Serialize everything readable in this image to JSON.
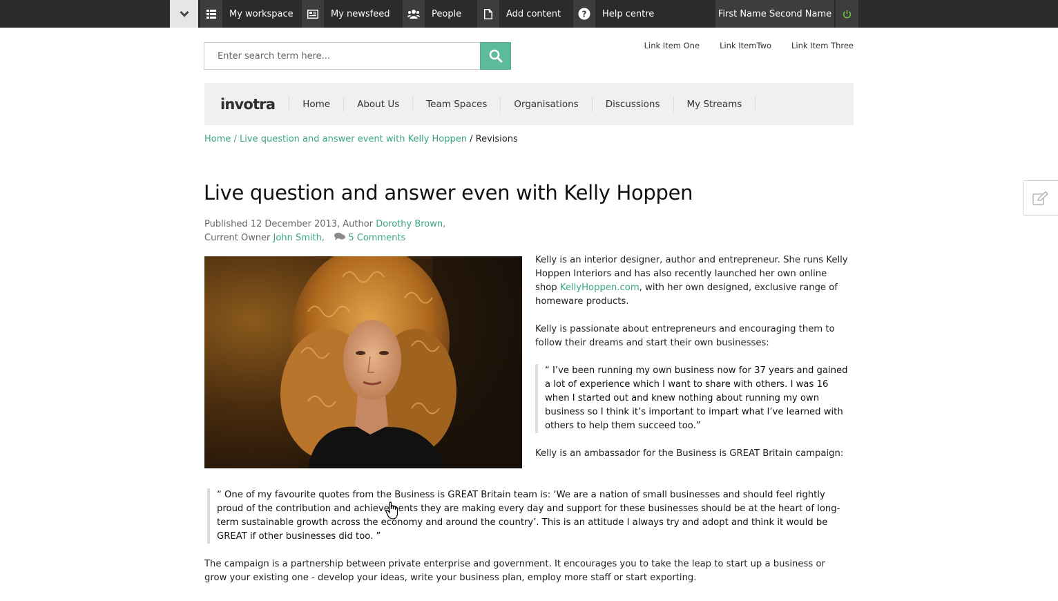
{
  "toolbar": {
    "items": [
      {
        "label": "My workspace",
        "icon": "grid-list-icon"
      },
      {
        "label": "My newsfeed",
        "icon": "newspaper-icon"
      },
      {
        "label": "People",
        "icon": "people-icon"
      },
      {
        "label": "Add content",
        "icon": "document-icon"
      },
      {
        "label": "Help centre",
        "icon": "question-icon"
      }
    ],
    "user_name": "First Name Second Name",
    "power_color": "#6bbf3a"
  },
  "search": {
    "placeholder": "Enter search term here...",
    "button_color": "#5dba9a"
  },
  "utility_links": [
    "Link Item One",
    "Link ItemTwo",
    "Link Item Three"
  ],
  "nav": {
    "logo": "invotra",
    "items": [
      "Home",
      "About Us",
      "Team Spaces",
      "Organisations",
      "Discussions",
      "My Streams"
    ]
  },
  "breadcrumb": {
    "home": "Home",
    "sep1": " / ",
    "parent": "Live question and answer event with Kelly Hoppen",
    "sep2": " / ",
    "current": "Revisions"
  },
  "article": {
    "title": "Live question and answer even with Kelly Hoppen",
    "meta": {
      "published_prefix": "Published 12 December 2013, Author ",
      "author": "Dorothy Brown,",
      "owner_prefix": "Current Owner ",
      "owner": "John Smith,",
      "comments": "5 Comments"
    },
    "p1_before_link": "Kelly is an interior designer, author and entrepreneur. She runs Kelly Hoppen Interiors and has also recently launched her own online shop ",
    "p1_link": "KellyHoppen.com",
    "p1_after_link": ", with her own designed, exclusive range of homeware products.",
    "p2": "Kelly is passionate about entrepreneurs and encouraging them to follow their dreams and start their own businesses:",
    "quote1": "“ I’ve been running my own business now for 37 years and gained a lot of experience which I want to share with others. I was 16 when I started out and knew nothing about running my own business so I think it’s important to impart what I’ve learned with others to help them succeed too.”",
    "p3": "Kelly is an ambassador for the Business is GREAT Britain campaign:",
    "quote2": "“ One of my favourite quotes from the Business is GREAT Britain team is: ‘We are a nation of small businesses and should feel rightly proud of the contribution and achievements they are making every day and support for these businesses should be at the heart of long-term sustainable growth across the economy and around the country’. This is an attitude I always try and adopt and think it would be GREAT if other businesses did too. ”",
    "p4": "The campaign is a partnership between private enterprise and government. It encourages you to take the leap to start up a business or grow your existing one - develop your ideas, write your business plan, employ more staff or start exporting."
  },
  "accent_color": "#3aa57f"
}
